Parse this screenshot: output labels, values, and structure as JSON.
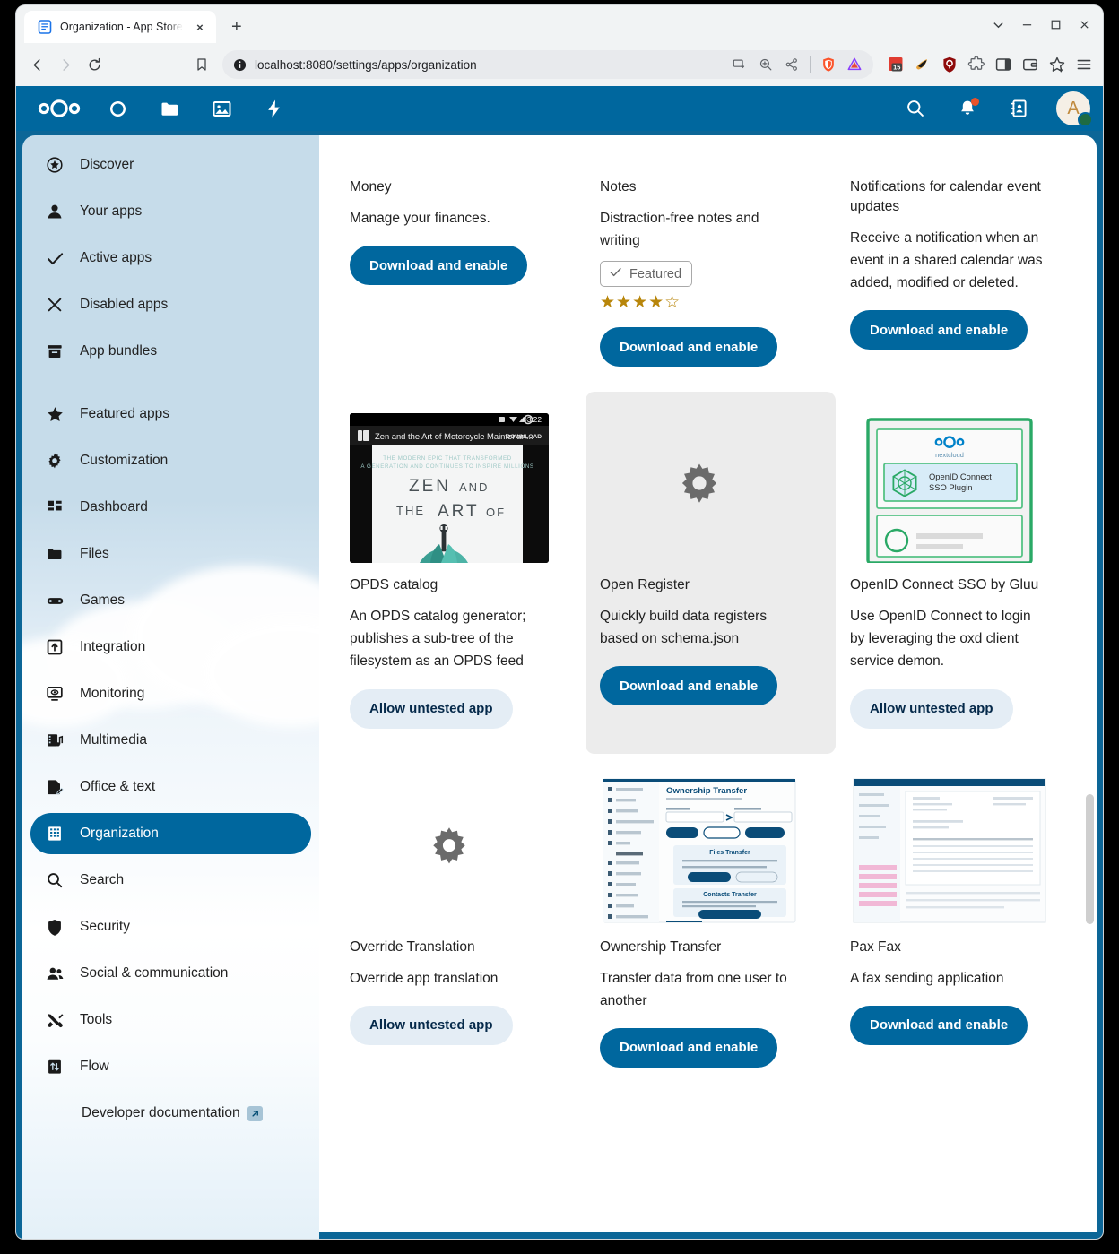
{
  "browser": {
    "tab": {
      "title": "Organization - App Store",
      "favicon": "document-icon",
      "close": "×"
    },
    "new_tab": "+",
    "url": "localhost:8080/settings/apps/organization",
    "window_controls": {
      "minimize": "–",
      "maximize": "□",
      "close": "✕",
      "tab_search": "⌵"
    },
    "nav": {
      "back": "back-icon",
      "forward": "forward-icon",
      "reload": "reload-icon",
      "bookmark": "bookmark-icon"
    },
    "omnibox_icons": [
      "site-info-icon",
      "cast-icon",
      "zoom-icon",
      "share-icon",
      "brave-shields-icon",
      "brave-rewards-icon"
    ],
    "extension_icons": [
      "calendar-15-icon",
      "torch-icon",
      "ublock-origin-icon",
      "puzzle-icon",
      "sidebar-icon",
      "wallet-icon",
      "bookmark-star-icon",
      "menu-icon"
    ]
  },
  "header": {
    "logo": "nextcloud-logo",
    "nav_items": [
      {
        "name": "dashboard",
        "icon": "circle-icon"
      },
      {
        "name": "files",
        "icon": "folder-icon"
      },
      {
        "name": "photos",
        "icon": "image-icon"
      },
      {
        "name": "activity",
        "icon": "lightning-icon"
      }
    ],
    "right_items": [
      {
        "name": "search",
        "icon": "search-icon"
      },
      {
        "name": "notifications",
        "icon": "bell-icon",
        "has_badge": true
      },
      {
        "name": "contacts",
        "icon": "contacts-icon"
      }
    ],
    "avatar": {
      "initial": "A",
      "status": "online"
    }
  },
  "sidebar": {
    "groups": [
      [
        {
          "label": "Discover",
          "icon": "star-circle-icon"
        },
        {
          "label": "Your apps",
          "icon": "person-icon"
        },
        {
          "label": "Active apps",
          "icon": "check-icon"
        },
        {
          "label": "Disabled apps",
          "icon": "close-icon"
        },
        {
          "label": "App bundles",
          "icon": "archive-icon"
        }
      ],
      [
        {
          "label": "Featured apps",
          "icon": "star-icon"
        },
        {
          "label": "Customization",
          "icon": "gear-icon"
        },
        {
          "label": "Dashboard",
          "icon": "dashboard-icon"
        },
        {
          "label": "Files",
          "icon": "folder-icon"
        },
        {
          "label": "Games",
          "icon": "gamepad-icon"
        },
        {
          "label": "Integration",
          "icon": "integration-icon"
        },
        {
          "label": "Monitoring",
          "icon": "monitor-icon"
        },
        {
          "label": "Multimedia",
          "icon": "multimedia-icon"
        },
        {
          "label": "Office & text",
          "icon": "document-edit-icon"
        },
        {
          "label": "Organization",
          "icon": "building-icon",
          "active": true
        },
        {
          "label": "Search",
          "icon": "search-icon"
        },
        {
          "label": "Security",
          "icon": "shield-icon"
        },
        {
          "label": "Social & communication",
          "icon": "people-icon"
        },
        {
          "label": "Tools",
          "icon": "tools-icon"
        },
        {
          "label": "Flow",
          "icon": "flow-icon"
        }
      ]
    ],
    "developer_documentation": {
      "label": "Developer documentation",
      "icon": "external-link-icon"
    }
  },
  "apps": [
    {
      "name": "Money",
      "description": "Manage your finances.",
      "button": "Download and enable",
      "button_style": "primary",
      "thumbnail": "money-screenshot",
      "featured": null,
      "rating": null
    },
    {
      "name": "Notes",
      "description": "Distraction-free notes and writing",
      "button": "Download and enable",
      "button_style": "primary",
      "thumbnail": "notes-screenshot",
      "featured": "Featured",
      "rating": 4,
      "rating_max": 5
    },
    {
      "name": "Notifications for calendar event updates",
      "description": "Receive a notification when an event in a shared calendar was added, modified or deleted.",
      "button": "Download and enable",
      "button_style": "primary",
      "thumbnail": "calendar-screenshot",
      "featured": null,
      "rating": null
    },
    {
      "name": "OPDS catalog",
      "description": "An OPDS catalog generator; publishes a sub-tree of the filesystem as an OPDS feed",
      "button": "Allow untested app",
      "button_style": "secondary",
      "thumbnail": "opds-screenshot",
      "thumbnail_caption": "Zen and the Art of Motorcycle Maintenan...",
      "thumbnail_download": "DOWNLOAD",
      "thumbnail_time": "03:22",
      "thumbnail_title_lines": [
        "THE MODERN EPIC THAT TRANSFORMED",
        "A GENERATION AND CONTINUES TO INSPIRE MILLIONS",
        "ZEN AND",
        "THE ART OF"
      ],
      "featured": null,
      "rating": null
    },
    {
      "name": "Open Register",
      "description": "Quickly build data registers based on schema.json",
      "button": "Download and enable",
      "button_style": "primary",
      "thumbnail": "gear-placeholder-icon",
      "highlighted": true,
      "featured": null,
      "rating": null
    },
    {
      "name": "OpenID Connect SSO by Gluu",
      "description": "Use OpenID Connect to login by leveraging the oxd client service demon.",
      "button": "Allow untested app",
      "button_style": "secondary",
      "thumbnail": "openid-diagram",
      "thumbnail_brand": "nextcloud",
      "thumbnail_label": "OpenID Connect SSO Plugin",
      "featured": null,
      "rating": null
    },
    {
      "name": "Override Translation",
      "description": "Override app translation",
      "button": "Allow untested app",
      "button_style": "secondary",
      "thumbnail": "gear-placeholder-icon",
      "featured": null,
      "rating": null
    },
    {
      "name": "Ownership Transfer",
      "description": "Transfer data from one user to another",
      "button": "Download and enable",
      "button_style": "primary",
      "thumbnail": "ownership-transfer-screenshot",
      "featured": null,
      "rating": null
    },
    {
      "name": "Pax Fax",
      "description": "A fax sending application",
      "button": "Download and enable",
      "button_style": "primary",
      "thumbnail": "paxfax-screenshot",
      "featured": null,
      "rating": null
    }
  ],
  "colors": {
    "nextcloud_blue": "#00679e",
    "primary_button": "#00679e",
    "secondary_button": "#e4edf5",
    "star_gold": "#b8860b",
    "notification_dot": "#e8522a",
    "status_online": "#1e6b42",
    "card_hover": "#ececec"
  }
}
